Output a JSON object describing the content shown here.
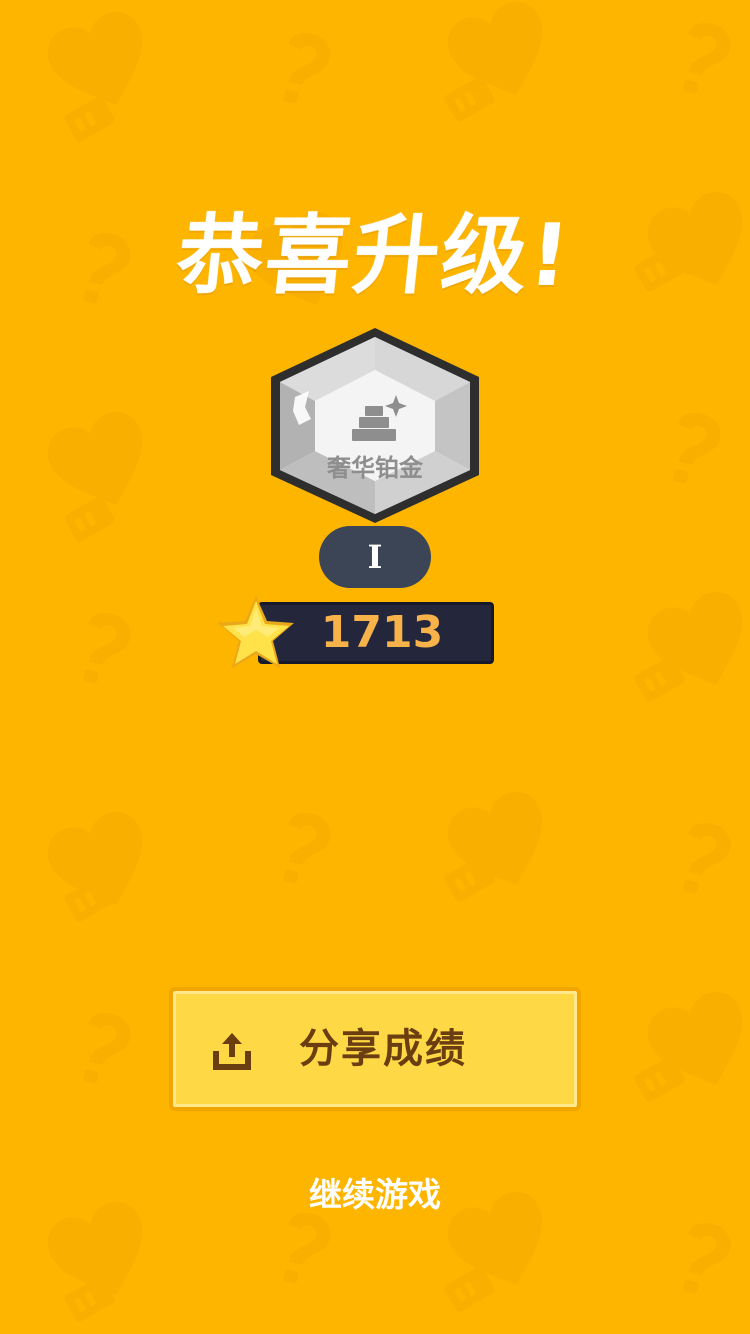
{
  "title": "恭喜升级!",
  "rank": {
    "badge_icon": "gold-bars-icon",
    "name": "奢华铂金",
    "tier": "I"
  },
  "score": {
    "icon": "star-icon",
    "value": "1713"
  },
  "share_button": {
    "icon": "share-upload-icon",
    "label": "分享成绩"
  },
  "continue_label": "继续游戏",
  "colors": {
    "background": "#FDB500",
    "button": "#FFD845",
    "button_text": "#6B3E11",
    "score_text": "#F7B24A",
    "score_bar": "#24273C",
    "tier_pill": "#3C4556"
  }
}
